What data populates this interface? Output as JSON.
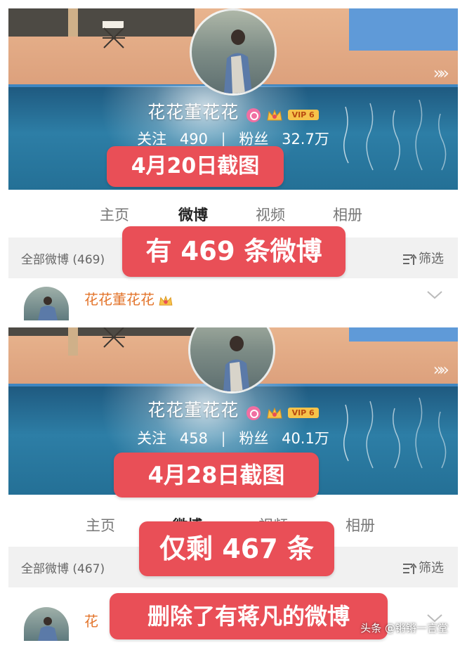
{
  "colors": {
    "tag_red": "#e94f57",
    "name_orange": "#e3742b",
    "pool_blue": "#2d7ea6",
    "wall_peach": "#e8b48e",
    "vip_gold": "#f6c34a",
    "filter_bg": "#f1f1f1"
  },
  "screenshot1": {
    "username": "花花董花花",
    "vip_label": "VIP 6",
    "following_label": "关注",
    "following_count": "490",
    "fans_label": "粉丝",
    "fans_count": "32.7万",
    "stat_separator": "|",
    "more_icon": "»»",
    "overlay_date": "4月20日截图",
    "tabs": [
      "主页",
      "微博",
      "视频",
      "相册"
    ],
    "active_tab": "微博",
    "all_weibo": "全部微博 (469)",
    "filter_label": "筛选",
    "overlay_count": "有 469 条微博",
    "post_author": "花花董花花"
  },
  "screenshot2": {
    "username": "花花董花花",
    "vip_label": "VIP 6",
    "following_label": "关注",
    "following_count": "458",
    "fans_label": "粉丝",
    "fans_count": "40.1万",
    "stat_separator": "|",
    "more_icon": "»»",
    "overlay_date": "4月28日截图",
    "tabs": [
      "主页",
      "微博",
      "视频",
      "相册"
    ],
    "active_tab": "微博",
    "all_weibo": "全部微博 (467)",
    "filter_label": "筛选",
    "overlay_count": "仅剩 467 条",
    "overlay_note": "删除了有蒋凡的微博",
    "post_author_fragment": "花"
  },
  "watermark": "头条 @锵锵一言堂"
}
